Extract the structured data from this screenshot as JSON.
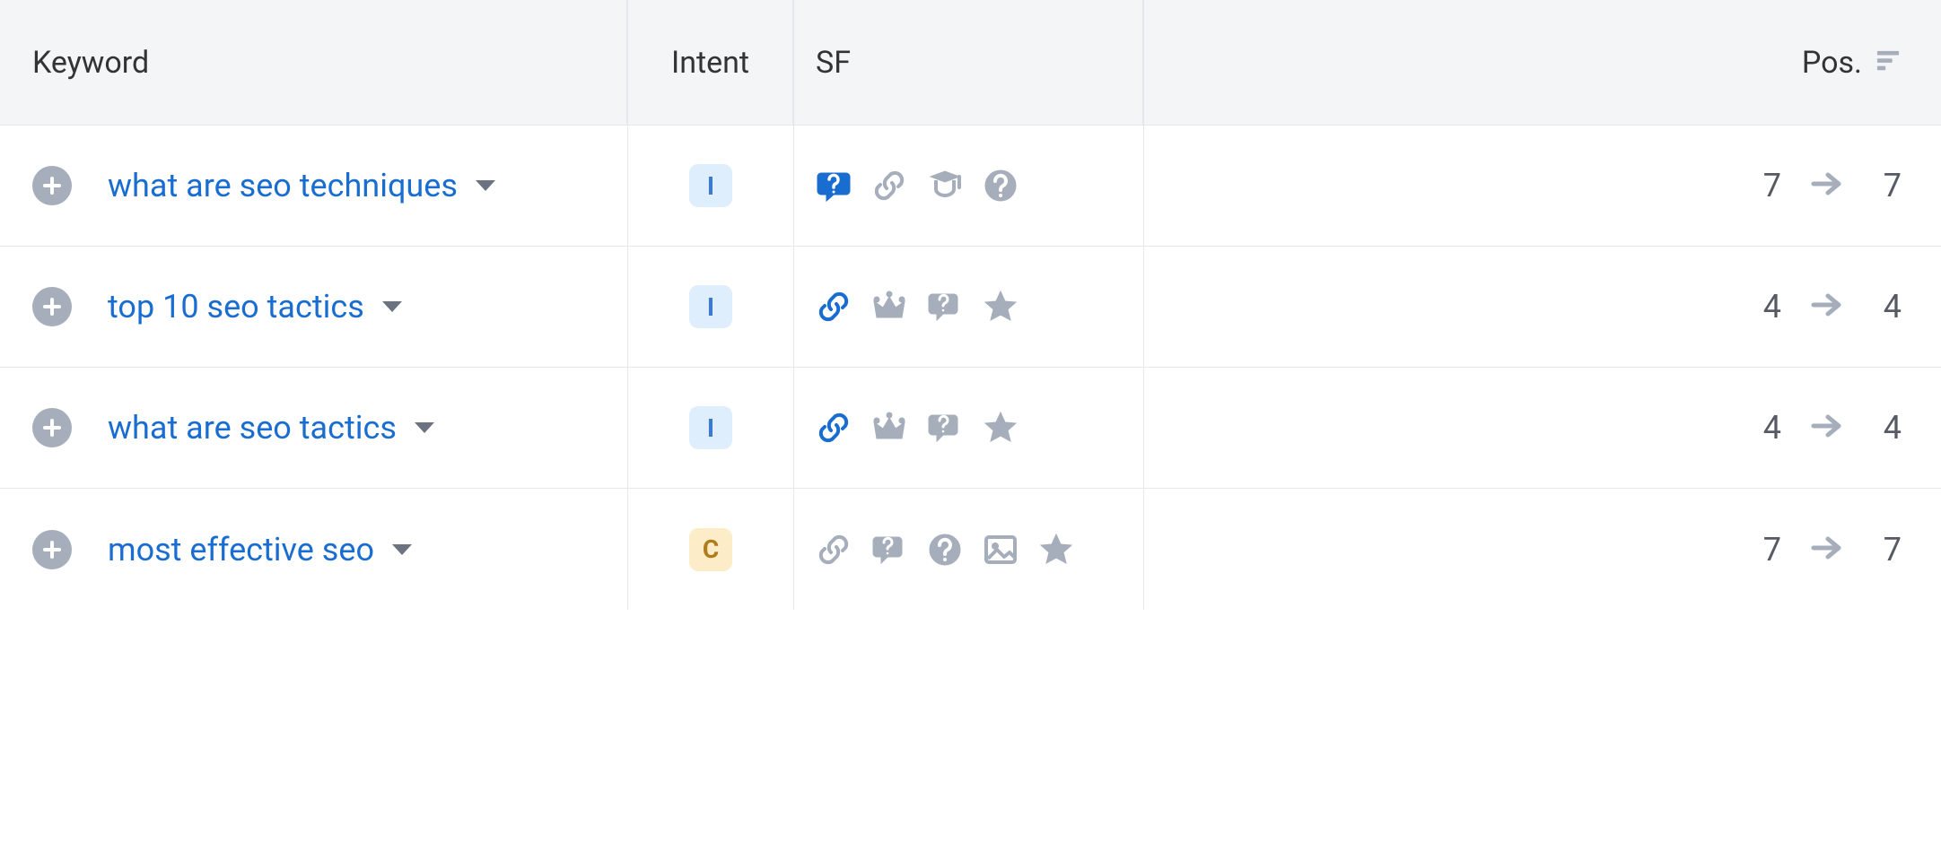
{
  "columns": {
    "keyword": "Keyword",
    "intent": "Intent",
    "sf": "SF",
    "pos": "Pos."
  },
  "intent_colors": {
    "I": {
      "bg": "#deeefc",
      "fg": "#3b7bc9"
    },
    "C": {
      "bg": "#fdecc8",
      "fg": "#b07c1b"
    }
  },
  "rows": [
    {
      "keyword": "what are seo techniques",
      "intent": "I",
      "sf": [
        "people-also-ask-blue",
        "link-gray",
        "knowledge-gray",
        "question-gray"
      ],
      "pos_prev": "7",
      "pos_cur": "7"
    },
    {
      "keyword": "top 10 seo tactics",
      "intent": "I",
      "sf": [
        "link-blue",
        "crown-gray",
        "faq-gray",
        "star-gray"
      ],
      "pos_prev": "4",
      "pos_cur": "4"
    },
    {
      "keyword": "what are seo tactics",
      "intent": "I",
      "sf": [
        "link-blue",
        "crown-gray",
        "faq-gray",
        "star-gray"
      ],
      "pos_prev": "4",
      "pos_cur": "4"
    },
    {
      "keyword": "most effective seo",
      "intent": "C",
      "sf": [
        "link-gray",
        "faq-gray",
        "question-gray",
        "image-gray",
        "star-gray"
      ],
      "pos_prev": "7",
      "pos_cur": "7"
    }
  ]
}
